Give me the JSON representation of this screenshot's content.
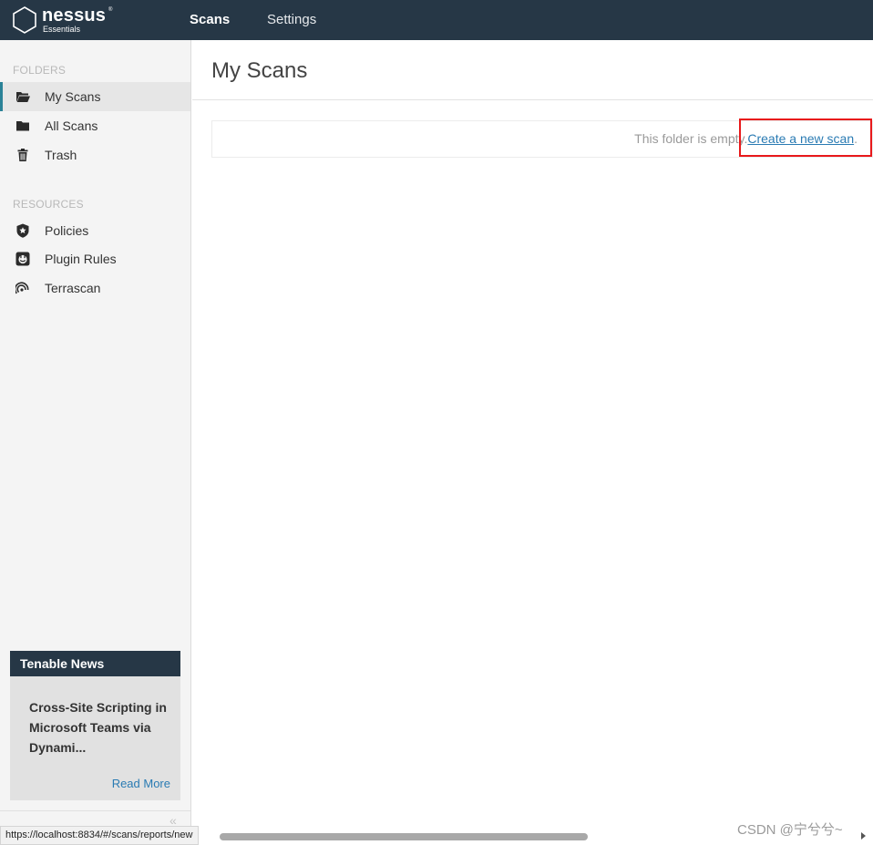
{
  "app": {
    "brand": "nessus",
    "edition": "Essentials",
    "trademark": "®"
  },
  "topnav": {
    "items": [
      {
        "label": "Scans",
        "active": true
      },
      {
        "label": "Settings",
        "active": false
      }
    ]
  },
  "sidebar": {
    "folders_label": "FOLDERS",
    "folders": [
      {
        "label": "My Scans",
        "icon": "folder-open-icon",
        "active": true
      },
      {
        "label": "All Scans",
        "icon": "folder-icon",
        "active": false
      },
      {
        "label": "Trash",
        "icon": "trash-icon",
        "active": false
      }
    ],
    "resources_label": "RESOURCES",
    "resources": [
      {
        "label": "Policies",
        "icon": "shield-star-icon"
      },
      {
        "label": "Plugin Rules",
        "icon": "plugin-icon"
      },
      {
        "label": "Terrascan",
        "icon": "signal-icon"
      }
    ],
    "collapse_glyph": "«"
  },
  "news": {
    "heading": "Tenable News",
    "title": "Cross-Site Scripting in Microsoft Teams via Dynami...",
    "read_more": "Read More"
  },
  "main": {
    "title": "My Scans",
    "empty_text": "This folder is empty.",
    "create_link": "Create a new scan",
    "create_suffix": "."
  },
  "statusbar": {
    "url": "https://localhost:8834/#/scans/reports/new"
  },
  "watermark": "CSDN @宁兮兮~",
  "colors": {
    "topbar": "#263746",
    "accent": "#2a8297",
    "link": "#2a7bb3",
    "highlight": "#e8191b"
  }
}
